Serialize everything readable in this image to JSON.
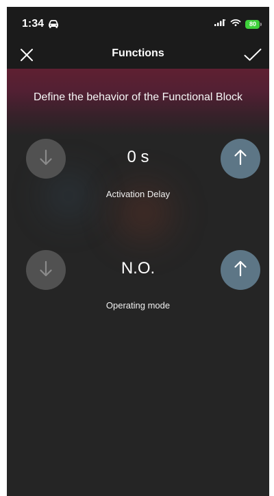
{
  "status_bar": {
    "time": "1:34",
    "battery_level": "80",
    "icons": [
      "car-icon",
      "signal-icon",
      "wifi-icon",
      "battery-charging-icon"
    ]
  },
  "navbar": {
    "title": "Functions",
    "left_icon": "close-icon",
    "right_icon": "check-icon"
  },
  "header": {
    "text": "Define the behavior of the Functional Block"
  },
  "controls": [
    {
      "value": "0 s",
      "label": "Activation Delay"
    },
    {
      "value": "N.O.",
      "label": "Operating mode"
    }
  ],
  "colors": {
    "background": "#252525",
    "top_bar": "#1b1b1b",
    "header_gradient_start": "#5f2032",
    "decrement_button": "#515151",
    "increment_button": "#5d7686",
    "battery": "#3ed13b",
    "text": "#ffffff"
  }
}
